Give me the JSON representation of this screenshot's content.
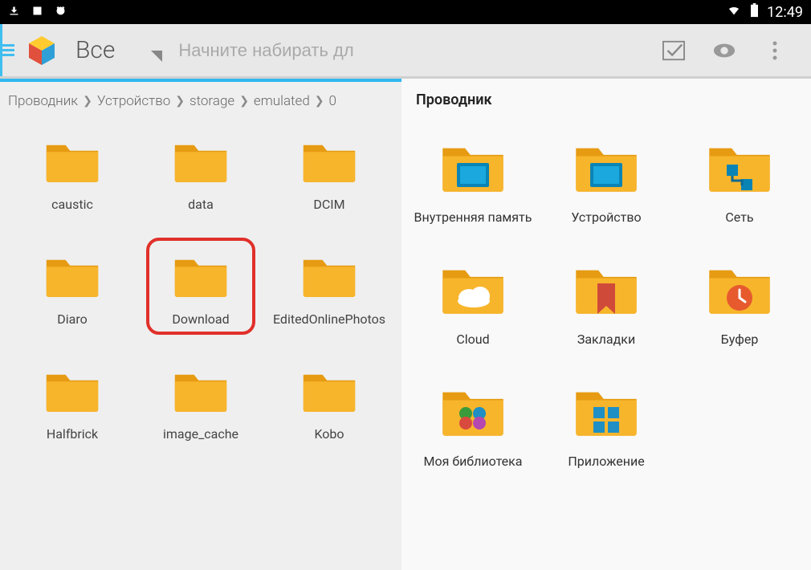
{
  "statusbar": {
    "time": "12:49"
  },
  "toolbar": {
    "filter_label": "Все",
    "search_placeholder": "Начните набирать дл"
  },
  "breadcrumb": [
    "Проводник",
    "Устройство",
    "storage",
    "emulated",
    "0"
  ],
  "right_title": "Проводник",
  "left_folders": [
    {
      "label": "caustic"
    },
    {
      "label": "data"
    },
    {
      "label": "DCIM"
    },
    {
      "label": "Diaro"
    },
    {
      "label": "Download",
      "highlight": true
    },
    {
      "label": "EditedOnlinePhotos"
    },
    {
      "label": "Halfbrick"
    },
    {
      "label": "image_cache"
    },
    {
      "label": "Kobo"
    }
  ],
  "right_folders": [
    {
      "label": "Внутренняя память",
      "overlay": "sdcard"
    },
    {
      "label": "Устройство",
      "overlay": "sdcard"
    },
    {
      "label": "Сеть",
      "overlay": "network"
    },
    {
      "label": "Cloud",
      "overlay": "cloud"
    },
    {
      "label": "Закладки",
      "overlay": "bookmark"
    },
    {
      "label": "Буфер",
      "overlay": "clock"
    },
    {
      "label": "Моя библиотека",
      "overlay": "circles"
    },
    {
      "label": "Приложение",
      "overlay": "apps"
    }
  ]
}
